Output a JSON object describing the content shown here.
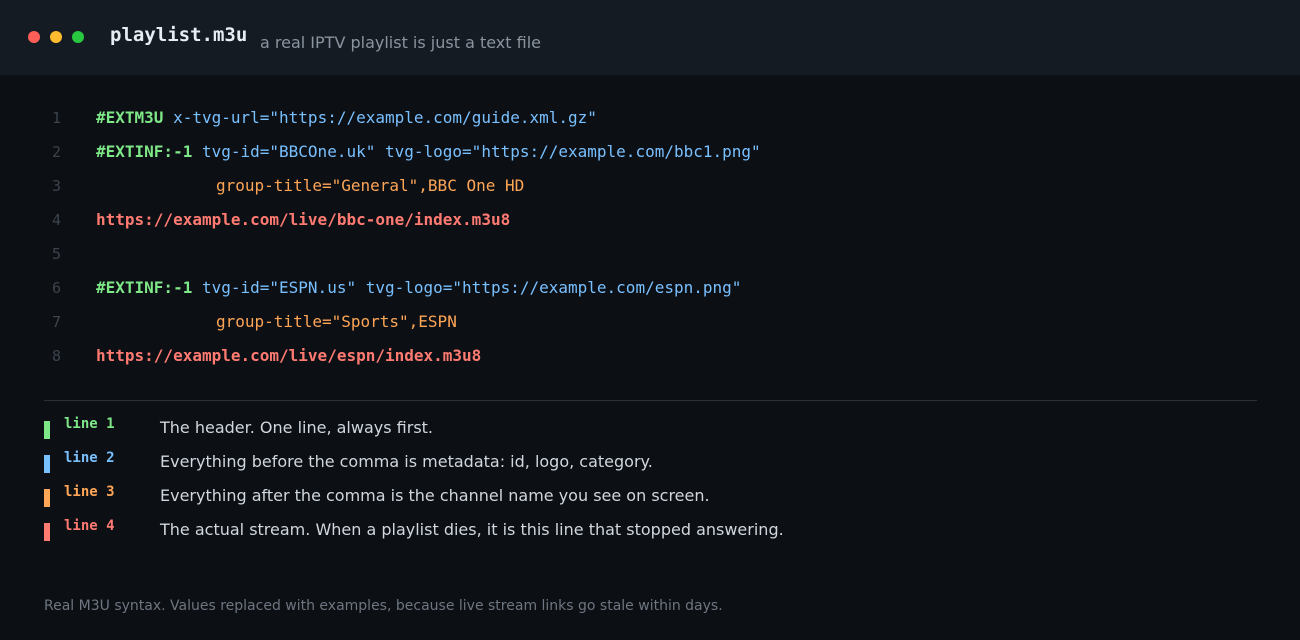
{
  "window": {
    "controls": [
      "close-dot",
      "minimize-dot",
      "maximize-dot"
    ],
    "filename": "playlist.m3u",
    "subtitle": "a real IPTV playlist is just a text file"
  },
  "colors": {
    "directive": "#7ee787",
    "attribute": "#79c0ff",
    "metadata": "#ffa657",
    "stream_url": "#ff7b72"
  },
  "code": {
    "lines": [
      {
        "number": "1",
        "directive": "#EXTM3U",
        "attrs": " x-tvg-url=\"https://example.com/guide.xml.gz\""
      },
      {
        "number": "2",
        "directive": "#EXTINF:-1",
        "attrs": " tvg-id=\"BBCOne.uk\" tvg-logo=\"https://example.com/bbc1.png\""
      },
      {
        "number": "3",
        "meta": "group-title=\"General\",BBC One HD"
      },
      {
        "number": "4",
        "url": "https://example.com/live/bbc-one/index.m3u8"
      },
      {
        "number": "5"
      },
      {
        "number": "6",
        "directive": "#EXTINF:-1",
        "attrs": " tvg-id=\"ESPN.us\" tvg-logo=\"https://example.com/espn.png\""
      },
      {
        "number": "7",
        "meta": "group-title=\"Sports\",ESPN"
      },
      {
        "number": "8",
        "url": "https://example.com/live/espn/index.m3u8"
      }
    ]
  },
  "legend": [
    {
      "label": "line 1",
      "text": "The header. One line, always first."
    },
    {
      "label": "line 2",
      "text": "Everything before the comma is metadata: id, logo, category."
    },
    {
      "label": "line 3",
      "text": "Everything after the comma is the channel name you see on screen."
    },
    {
      "label": "line 4",
      "text": "The actual stream. When a playlist dies, it is this line that stopped answering."
    }
  ],
  "footer": "Real M3U syntax. Values replaced with examples, because live stream links go stale within days."
}
